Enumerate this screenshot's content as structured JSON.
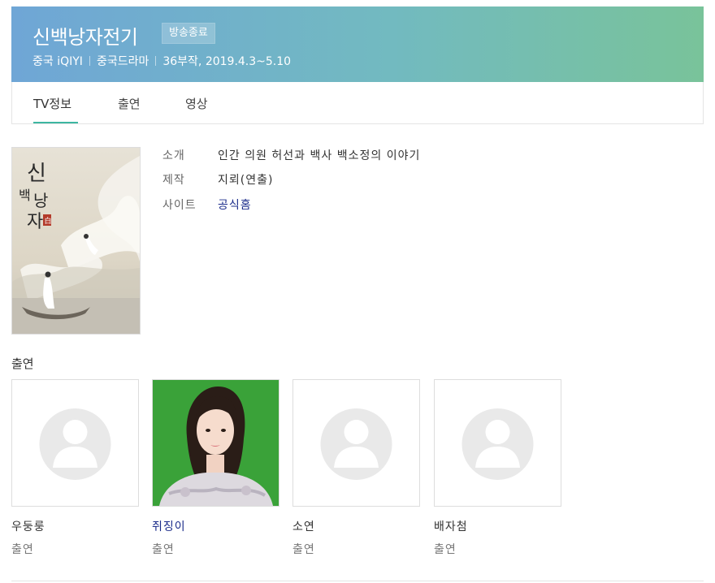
{
  "header": {
    "title": "신백낭자전기",
    "badge": "방송종료",
    "meta": [
      "중국 iQIYI",
      "중국드라마",
      "36부작, 2019.4.3~5.10"
    ],
    "gradient": [
      "#6fa6d6",
      "#79c39a"
    ]
  },
  "tabs": [
    {
      "label": "TV정보",
      "active": true
    },
    {
      "label": "출연",
      "active": false
    },
    {
      "label": "영상",
      "active": false
    }
  ],
  "poster": {
    "calligraphy": [
      "신",
      "백",
      "낭",
      "자"
    ],
    "seal": "白"
  },
  "info": [
    {
      "label": "소개",
      "value": "인간 의원 허선과 백사 백소정의 이야기"
    },
    {
      "label": "제작",
      "value": "지뢰(연출)"
    },
    {
      "label": "사이트",
      "value": "공식홈"
    }
  ],
  "cast_section_title": "출연",
  "cast": [
    {
      "name": "우둥룽",
      "role": "출연",
      "photo": "placeholder-avatar"
    },
    {
      "name": "쥐징이",
      "role": "출연",
      "photo": "portrait"
    },
    {
      "name": "소연",
      "role": "출연",
      "photo": "placeholder-avatar"
    },
    {
      "name": "배자첨",
      "role": "출연",
      "photo": "placeholder-avatar"
    }
  ],
  "colors": {
    "accent": "#3db6a1",
    "link": "#1a2b8a"
  }
}
